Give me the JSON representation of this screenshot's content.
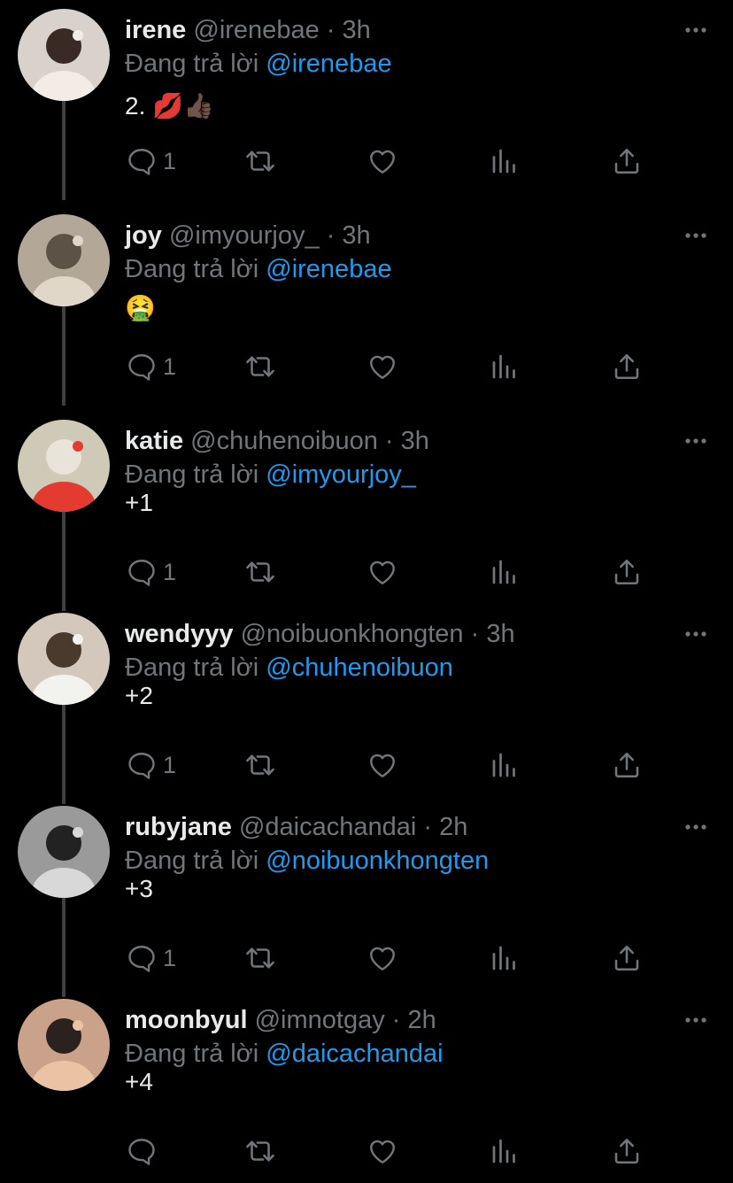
{
  "tweets": [
    {
      "name": "irene",
      "handle": "@irenebae",
      "time": "3h",
      "reply_prefix": "Đang trả lời",
      "reply_to": "@irenebae",
      "text": "2. 💋👍🏿",
      "reply_count": "1",
      "avatar": {
        "bg": "#d9d2cc",
        "fg": "#3a2a24",
        "accent": "#f3ece6"
      }
    },
    {
      "name": "joy",
      "handle": "@imyourjoy_",
      "time": "3h",
      "reply_prefix": "Đang trả lời",
      "reply_to": "@irenebae",
      "text": "🤮",
      "reply_count": "1",
      "avatar": {
        "bg": "#b3a898",
        "fg": "#5d5246",
        "accent": "#e0d7c8"
      }
    },
    {
      "name": "katie",
      "handle": "@chuhenoibuon",
      "time": "3h",
      "reply_prefix": "Đang trả lời",
      "reply_to": "@imyourjoy_",
      "text": "+1",
      "reply_count": "1",
      "avatar": {
        "bg": "#cfc9b8",
        "fg": "#e8e4da",
        "accent": "#e33b2f"
      }
    },
    {
      "name": "wendyyy",
      "handle": "@noibuonkhongten",
      "time": "3h",
      "reply_prefix": "Đang trả lời",
      "reply_to": "@chuhenoibuon",
      "text": "+2",
      "reply_count": "1",
      "avatar": {
        "bg": "#d3c8bb",
        "fg": "#4a3a2e",
        "accent": "#f2f2ee"
      }
    },
    {
      "name": "rubyjane",
      "handle": "@daicachandai",
      "time": "2h",
      "reply_prefix": "Đang trả lời",
      "reply_to": "@noibuonkhongten",
      "text": "+3",
      "reply_count": "1",
      "avatar": {
        "bg": "#9a9a9a",
        "fg": "#222222",
        "accent": "#d8d8d8"
      }
    },
    {
      "name": "moonbyul",
      "handle": "@imnotgay",
      "time": "2h",
      "reply_prefix": "Đang trả lời",
      "reply_to": "@daicachandai",
      "text": "+4",
      "reply_count": "",
      "avatar": {
        "bg": "#caa28a",
        "fg": "#2b2220",
        "accent": "#e9c3a4"
      }
    }
  ],
  "colors": {
    "background": "#000000",
    "primary_text": "#e7e9ea",
    "secondary_text": "#71767b",
    "link": "#1d9bf0",
    "thread_line": "#3e4144"
  },
  "icons": {
    "more": "more-horizontal-icon",
    "reply": "comment-bubble-icon",
    "retweet": "retweet-icon",
    "like": "heart-icon",
    "views": "bar-chart-icon",
    "share": "share-upload-icon"
  }
}
